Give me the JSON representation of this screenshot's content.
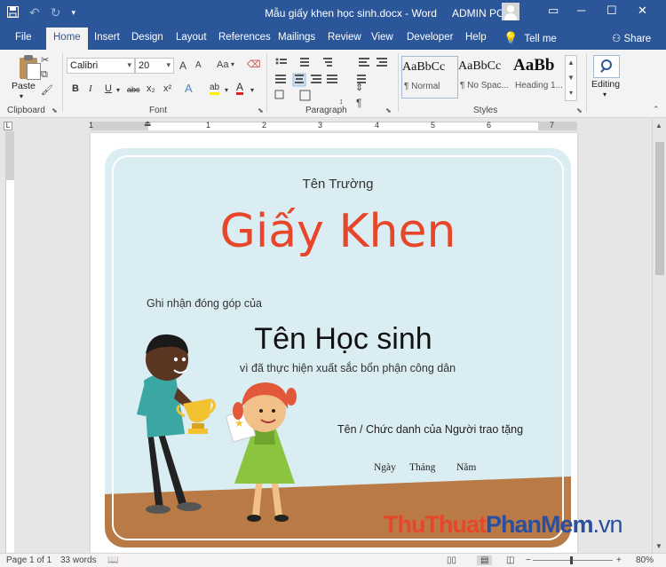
{
  "window": {
    "title": "Mẫu giấy khen học sinh.docx - Word",
    "user": "ADMIN PC",
    "qat": {
      "save_icon": "save-icon",
      "undo_icon": "undo-icon",
      "redo_icon": "redo-icon",
      "customize_icon": "customize-qat-icon"
    },
    "buttons": {
      "ribbon_options": "▭",
      "minimize": "─",
      "maximize": "☐",
      "close": "✕"
    }
  },
  "ribbon_tabs": [
    "File",
    "Home",
    "Insert",
    "Design",
    "Layout",
    "References",
    "Mailings",
    "Review",
    "View",
    "Developer",
    "Help"
  ],
  "active_tab": "Home",
  "tell_me": "Tell me",
  "share": "Share",
  "clipboard": {
    "paste": "Paste",
    "label": "Clipboard"
  },
  "font": {
    "name": "Calibri",
    "size": "20",
    "label": "Font",
    "grow": "A",
    "shrink": "A",
    "case": "Aa",
    "bold": "B",
    "italic": "I",
    "underline": "U",
    "strike": "abc",
    "subscript": "x₂",
    "superscript": "x²",
    "effects": "A",
    "highlight": "ab",
    "color": "A"
  },
  "paragraph": {
    "label": "Paragraph",
    "pilcrow": "¶"
  },
  "styles": {
    "label": "Styles",
    "items": [
      {
        "preview": "AaBbCc",
        "name": "¶ Normal"
      },
      {
        "preview": "AaBbCc",
        "name": "¶ No Spac..."
      },
      {
        "preview": "AaBb",
        "name": "Heading 1..."
      }
    ]
  },
  "editing": {
    "label": "Editing"
  },
  "ruler": {
    "marks": [
      "1",
      "1",
      "2",
      "3",
      "4",
      "5",
      "6",
      "7"
    ]
  },
  "certificate": {
    "school": "Tên Trường",
    "heading": "Giấy Khen",
    "acknowledge": "Ghi nhận đóng góp của",
    "student": "Tên Học sinh",
    "reason": "vì đã thực hiện xuất sắc bổn phận công dân",
    "giver": "Tên / Chức danh của Người trao tặng",
    "day": "Ngày",
    "month": "Tháng",
    "year": "Năm",
    "colors": {
      "background": "#d9edf2",
      "ground": "#b97a45",
      "heading": "#e8462a"
    }
  },
  "watermark": {
    "part1": "ThuThuat",
    "part2": "PhanMem",
    "part3": ".vn"
  },
  "status": {
    "page": "Page 1 of 1",
    "words": "33 words",
    "zoom": "80%",
    "zoom_minus": "−",
    "zoom_plus": "+"
  }
}
